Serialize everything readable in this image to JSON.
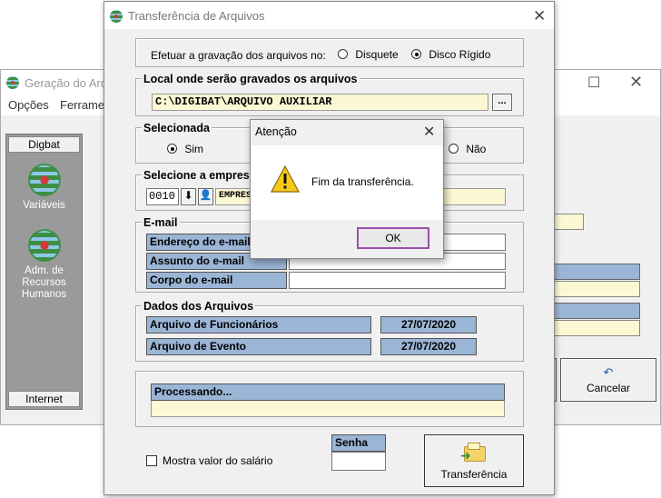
{
  "background_window": {
    "title": "Geração do Arq",
    "menu": [
      "Opções",
      "Ferramen"
    ],
    "sidebar": {
      "top_button": "Digbat",
      "items": [
        "Variáveis",
        "Adm. de Recursos Humanos"
      ],
      "bottom_button": "Internet"
    },
    "cancel_button": "Cancelar"
  },
  "dialog": {
    "title": "Transferência de Arquivos",
    "save_option": {
      "label": "Efetuar a gravação dos arquivos no:",
      "options": [
        "Disquete",
        "Disco Rígido"
      ],
      "selected": "Disco Rígido"
    },
    "location": {
      "label": "Local onde serão gravados os arquivos",
      "path": "C:\\DIGIBAT\\ARQUIVO AUXILIAR",
      "browse_label": "..."
    },
    "selecionada": {
      "label": "Selecionada",
      "options": [
        "Sim",
        "Não"
      ],
      "selected": "Sim"
    },
    "empresa": {
      "label": "Selecione a empresa",
      "code": "0010",
      "name": "EMPRES"
    },
    "email": {
      "label": "E-mail",
      "fields": [
        "Endereço do  e-mail",
        "Assunto do e-mail",
        "Corpo do e-mail"
      ]
    },
    "dados": {
      "label": "Dados dos Arquivos",
      "rows": [
        {
          "name": "Arquivo de Funcionários",
          "date": "27/07/2020"
        },
        {
          "name": "Arquivo de Evento",
          "date": "27/07/2020"
        }
      ]
    },
    "processando_label": "Processando...",
    "mostra_label": "Mostra valor do salário",
    "senha_label": "Senha",
    "transfer_button": "Transferência"
  },
  "alert": {
    "title": "Atenção",
    "message": "Fim da transferência.",
    "ok": "OK"
  },
  "colors": {
    "field_yellow": "#fcf8d4",
    "header_blue": "#9bb5d6",
    "ok_focus": "#9a4fa8",
    "sidebar_gray": "#9a9a9a"
  }
}
